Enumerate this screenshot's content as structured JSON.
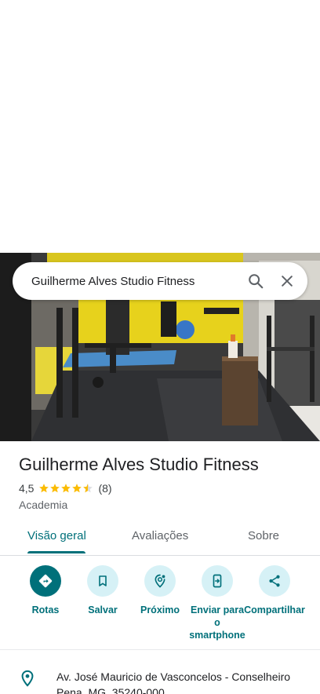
{
  "search": {
    "query": "Guilherme Alves Studio Fitness"
  },
  "place": {
    "name": "Guilherme Alves Studio Fitness",
    "rating": "4,5",
    "stars": 4.5,
    "review_count": "(8)",
    "category": "Academia"
  },
  "tabs": [
    {
      "label": "Visão geral",
      "active": true
    },
    {
      "label": "Avaliações",
      "active": false
    },
    {
      "label": "Sobre",
      "active": false
    }
  ],
  "actions": [
    {
      "label": "Rotas",
      "icon": "directions-icon"
    },
    {
      "label": "Salvar",
      "icon": "bookmark-icon"
    },
    {
      "label": "Próximo",
      "icon": "nearby-icon"
    },
    {
      "label": "Enviar para o smartphone",
      "icon": "send-to-phone-icon"
    },
    {
      "label": "Compartilhar",
      "icon": "share-icon"
    }
  ],
  "address": {
    "text": "Av. José Mauricio de Vasconcelos - Conselheiro Pena, MG, 35240-000",
    "icon": "location-pin-icon"
  },
  "colors": {
    "accent": "#00707a",
    "action_bg": "#d6f1f6",
    "star": "#fbbc04"
  }
}
